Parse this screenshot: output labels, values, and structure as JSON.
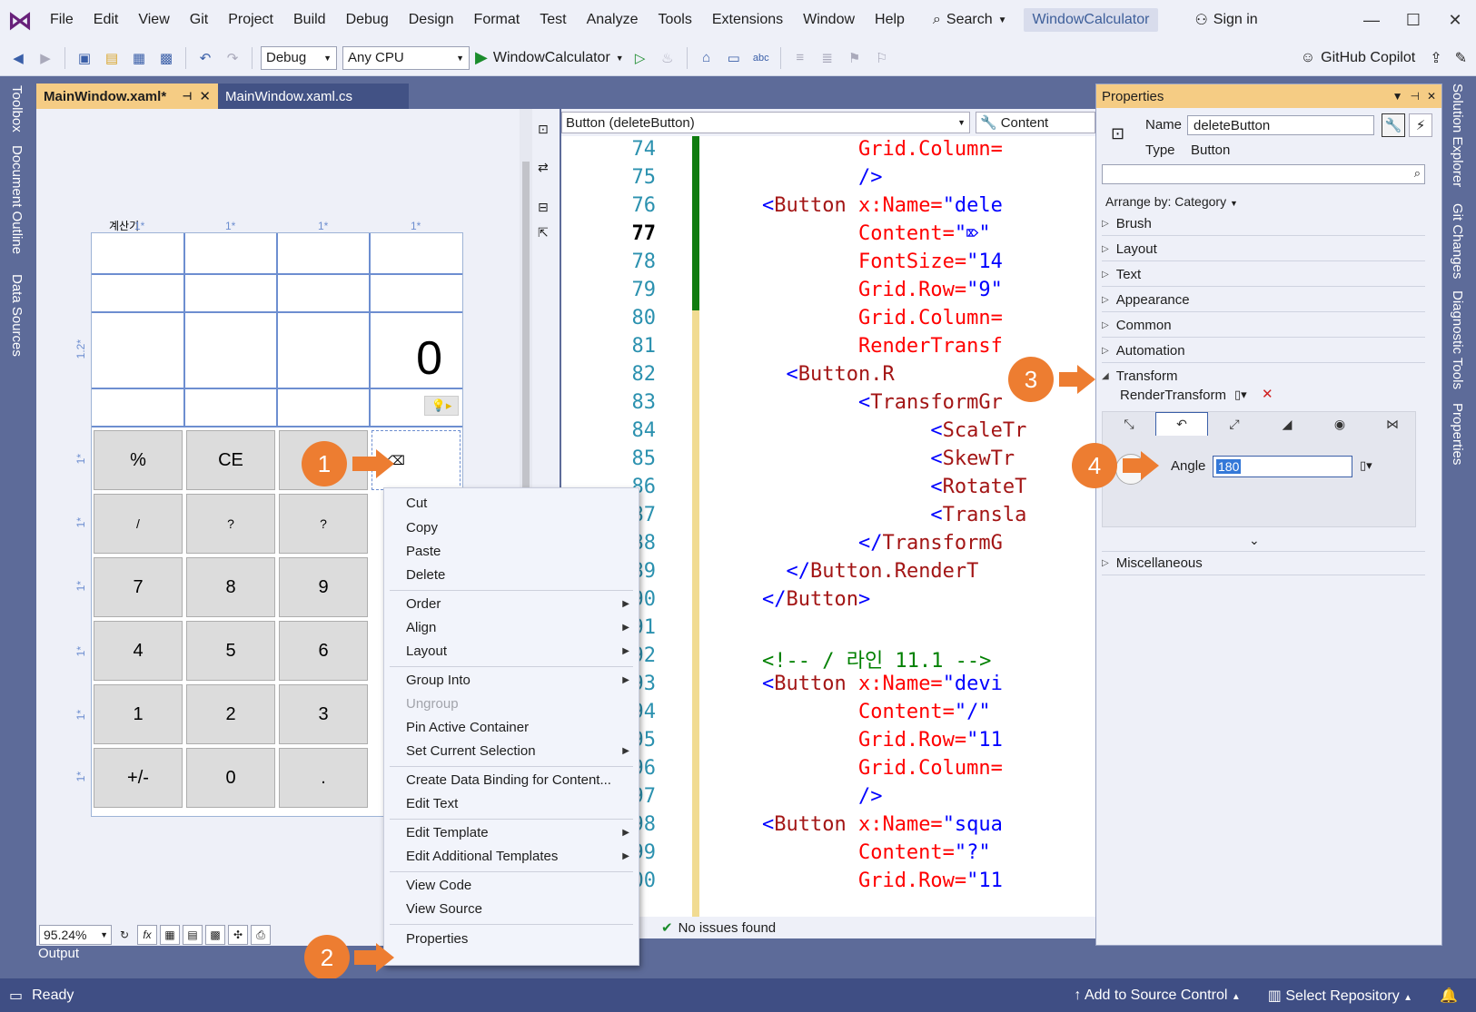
{
  "menu": {
    "items": [
      "File",
      "Edit",
      "View",
      "Git",
      "Project",
      "Build",
      "Debug",
      "Design",
      "Format",
      "Test",
      "Analyze",
      "Tools",
      "Extensions",
      "Window",
      "Help"
    ],
    "search_label": "Search",
    "solution_name": "WindowCalculator",
    "sign_in": "Sign in"
  },
  "toolbar": {
    "config": "Debug",
    "platform": "Any CPU",
    "start_label": "WindowCalculator",
    "copilot_label": "GitHub Copilot"
  },
  "left_rail": {
    "tabs": [
      "Toolbox",
      "Document Outline",
      "Data Sources"
    ]
  },
  "right_rail": {
    "tabs": [
      "Solution Explorer",
      "Git Changes",
      "Diagnostic Tools",
      "Properties"
    ]
  },
  "doc_tabs": {
    "main": "MainWindow.xaml*",
    "cs": "MainWindow.xaml.cs"
  },
  "designer": {
    "grid_title": "계산기",
    "col_markers": [
      "1*",
      "1*",
      "1*",
      "1*"
    ],
    "row_markers": [
      "1.2*",
      "1*",
      "1*",
      "1*",
      "1*",
      "1*",
      "1*"
    ],
    "display_value": "0",
    "buttons": {
      "r1": [
        "%",
        "CE",
        "⌫",
        ""
      ],
      "r2": [
        "/",
        "?",
        "?",
        ""
      ],
      "r3": [
        "7",
        "8",
        "9",
        ""
      ],
      "r4": [
        "4",
        "5",
        "6",
        ""
      ],
      "r5": [
        "1",
        "2",
        "3",
        ""
      ],
      "r6": [
        "+/-",
        "0",
        ".",
        ""
      ]
    },
    "zoom": "95.24%",
    "fx_label": "fx"
  },
  "output_tab": "Output",
  "code": {
    "nav_element": "Button (deleteButton)",
    "nav_property": "Content",
    "line_numbers": [
      "74",
      "75",
      "76",
      "77",
      "78",
      "79",
      "80",
      "81",
      "82",
      "83",
      "84",
      "85",
      "86",
      "87",
      "88",
      "89",
      "90",
      "91",
      "92",
      "93",
      "94",
      "95",
      "96",
      "97",
      "98",
      "99",
      "100"
    ],
    "current_line": "77",
    "lines": [
      {
        "n": "74",
        "indent": "            ",
        "parts": [
          [
            "attr",
            "Grid.Column="
          ]
        ]
      },
      {
        "n": "75",
        "indent": "            ",
        "parts": [
          [
            "val",
            "/>"
          ]
        ]
      },
      {
        "n": "76",
        "indent": "    ",
        "parts": [
          [
            "tag",
            "<"
          ],
          [
            "kw",
            "Button"
          ],
          [
            "attr",
            " x:Name="
          ],
          [
            "val",
            "\"dele"
          ]
        ]
      },
      {
        "n": "77",
        "indent": "            ",
        "parts": [
          [
            "attr",
            "Content="
          ],
          [
            "val",
            "\"⌦\""
          ]
        ]
      },
      {
        "n": "78",
        "indent": "            ",
        "parts": [
          [
            "attr",
            "FontSize="
          ],
          [
            "val",
            "\"14"
          ]
        ]
      },
      {
        "n": "79",
        "indent": "            ",
        "parts": [
          [
            "attr",
            "Grid.Row="
          ],
          [
            "val",
            "\"9\""
          ]
        ]
      },
      {
        "n": "80",
        "indent": "            ",
        "parts": [
          [
            "attr",
            "Grid.Column="
          ]
        ]
      },
      {
        "n": "81",
        "indent": "            ",
        "parts": [
          [
            "attr",
            "RenderTransf"
          ]
        ]
      },
      {
        "n": "82",
        "indent": "      ",
        "parts": [
          [
            "tag",
            "<"
          ],
          [
            "kw",
            "Button.R"
          ]
        ]
      },
      {
        "n": "83",
        "indent": "            ",
        "parts": [
          [
            "tag",
            "<"
          ],
          [
            "kw",
            "TransformGr"
          ]
        ]
      },
      {
        "n": "84",
        "indent": "                  ",
        "parts": [
          [
            "tag",
            "<"
          ],
          [
            "kw",
            "ScaleTr"
          ]
        ]
      },
      {
        "n": "85",
        "indent": "                  ",
        "parts": [
          [
            "tag",
            "<"
          ],
          [
            "kw",
            "SkewTr"
          ]
        ]
      },
      {
        "n": "86",
        "indent": "                  ",
        "parts": [
          [
            "tag",
            "<"
          ],
          [
            "kw",
            "RotateT"
          ]
        ]
      },
      {
        "n": "87",
        "indent": "                  ",
        "parts": [
          [
            "tag",
            "<"
          ],
          [
            "kw",
            "Transla"
          ]
        ]
      },
      {
        "n": "88",
        "indent": "            ",
        "parts": [
          [
            "tag",
            "</"
          ],
          [
            "kw",
            "TransformG"
          ]
        ]
      },
      {
        "n": "89",
        "indent": "      ",
        "parts": [
          [
            "tag",
            "</"
          ],
          [
            "kw",
            "Button.RenderT"
          ]
        ]
      },
      {
        "n": "90",
        "indent": "    ",
        "parts": [
          [
            "tag",
            "</"
          ],
          [
            "kw",
            "Button"
          ],
          [
            "tag",
            ">"
          ]
        ]
      },
      {
        "n": "91",
        "indent": "",
        "parts": []
      },
      {
        "n": "92",
        "indent": "    ",
        "parts": [
          [
            "cmt",
            "<!-- / 라인 11.1 -->"
          ]
        ]
      },
      {
        "n": "93",
        "indent": "    ",
        "parts": [
          [
            "tag",
            "<"
          ],
          [
            "kw",
            "Button"
          ],
          [
            "attr",
            " x:Name="
          ],
          [
            "val",
            "\"devi"
          ]
        ]
      },
      {
        "n": "94",
        "indent": "            ",
        "parts": [
          [
            "attr",
            "Content="
          ],
          [
            "val",
            "\"/\""
          ]
        ]
      },
      {
        "n": "95",
        "indent": "            ",
        "parts": [
          [
            "attr",
            "Grid.Row="
          ],
          [
            "val",
            "\"11"
          ]
        ]
      },
      {
        "n": "96",
        "indent": "            ",
        "parts": [
          [
            "attr",
            "Grid.Column="
          ]
        ]
      },
      {
        "n": "97",
        "indent": "            ",
        "parts": [
          [
            "val",
            "/>"
          ]
        ]
      },
      {
        "n": "98",
        "indent": "    ",
        "parts": [
          [
            "tag",
            "<"
          ],
          [
            "kw",
            "Button"
          ],
          [
            "attr",
            " x:Name="
          ],
          [
            "val",
            "\"squa"
          ]
        ]
      },
      {
        "n": "99",
        "indent": "            ",
        "parts": [
          [
            "attr",
            "Content="
          ],
          [
            "val",
            "\"?\""
          ]
        ]
      },
      {
        "n": "100",
        "indent": "            ",
        "parts": [
          [
            "attr",
            "Grid.Row="
          ],
          [
            "val",
            "\"11"
          ]
        ]
      }
    ],
    "status": "No issues found"
  },
  "context_menu": {
    "cut": "Cut",
    "copy": "Copy",
    "paste": "Paste",
    "delete": "Delete",
    "order": "Order",
    "align": "Align",
    "layout": "Layout",
    "group_into": "Group Into",
    "ungroup": "Ungroup",
    "pin": "Pin Active Container",
    "set_selection": "Set Current Selection",
    "data_binding": "Create Data Binding for Content...",
    "edit_text": "Edit Text",
    "edit_template": "Edit Template",
    "edit_additional": "Edit Additional Templates",
    "view_code": "View Code",
    "view_source": "View Source",
    "properties": "Properties"
  },
  "properties": {
    "title": "Properties",
    "name_label": "Name",
    "name_value": "deleteButton",
    "type_label": "Type",
    "type_value": "Button",
    "arrange_by": "Arrange by: Category",
    "categories": [
      "Brush",
      "Layout",
      "Text",
      "Appearance",
      "Common",
      "Automation"
    ],
    "transform": "Transform",
    "render_transform": "RenderTransform",
    "angle_label": "Angle",
    "angle_value": "180",
    "misc": "Miscellaneous"
  },
  "callouts": [
    "1",
    "2",
    "3",
    "4"
  ],
  "status_bar": {
    "ready": "Ready",
    "source_control": "Add to Source Control",
    "select_repo": "Select Repository"
  },
  "colors": {
    "accent": "#ed7d31",
    "tab_active": "#f5cc84",
    "status": "#3f4e84"
  }
}
